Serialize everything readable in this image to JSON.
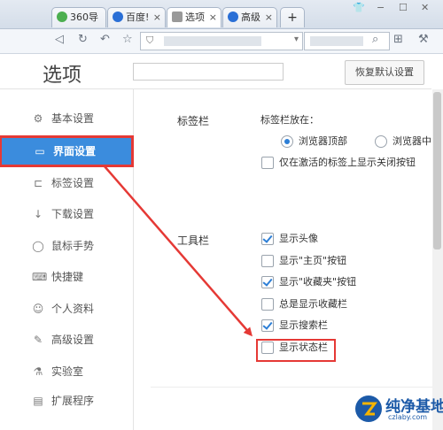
{
  "browser": {
    "tabs": [
      {
        "label": "360导",
        "icon": "360-icon",
        "color": "#4caf50"
      },
      {
        "label": "百度!",
        "icon": "baidu-paw-icon",
        "color": "#2a6fd6"
      },
      {
        "label": "选项",
        "icon": "gear-icon",
        "color": "#888888"
      },
      {
        "label": "高级",
        "icon": "baidu-paw-icon",
        "color": "#2a6fd6"
      }
    ],
    "new_tab": "+",
    "close_glyph": "×",
    "window_controls": [
      "👕",
      "−",
      "☐",
      "✕"
    ]
  },
  "options": {
    "title": "选项",
    "restore_default": "恢复默认设置"
  },
  "sidebar": {
    "items": [
      {
        "label": "基本设置",
        "icon": "gear-icon"
      },
      {
        "label": "界面设置",
        "icon": "window-icon"
      },
      {
        "label": "标签设置",
        "icon": "laptop-icon"
      },
      {
        "label": "下载设置",
        "icon": "download-icon"
      },
      {
        "label": "鼠标手势",
        "icon": "mouse-icon"
      },
      {
        "label": "快捷键",
        "icon": "keyboard-icon"
      },
      {
        "label": "个人资料",
        "icon": "user-icon"
      },
      {
        "label": "高级设置",
        "icon": "wrench-icon"
      },
      {
        "label": "实验室",
        "icon": "flask-icon"
      },
      {
        "label": "扩展程序",
        "icon": "extension-icon"
      }
    ],
    "selected": "界面设置"
  },
  "tabbar_section": {
    "title": "标签栏",
    "position_label": "标签栏放在：",
    "radio_top": "浏览器顶部",
    "radio_top_checked": true,
    "radio_mid": "浏览器中",
    "radio_mid_checked": false,
    "close_only_active": "仅在激活的标签上显示关闭按钮",
    "close_only_active_checked": false
  },
  "toolbar_section": {
    "title": "工具栏",
    "options": [
      {
        "label": "显示头像",
        "checked": true
      },
      {
        "label": "显示\"主页\"按钮",
        "checked": false
      },
      {
        "label": "显示\"收藏夹\"按钮",
        "checked": true
      },
      {
        "label": "总是显示收藏栏",
        "checked": false
      },
      {
        "label": "显示搜索栏",
        "checked": true
      },
      {
        "label": "显示状态栏",
        "checked": false
      }
    ]
  },
  "watermark": {
    "text": "纯净基地",
    "url": "czlaby.com"
  },
  "colors": {
    "accent": "#3b8cdd",
    "annotation_red": "#e53935"
  }
}
